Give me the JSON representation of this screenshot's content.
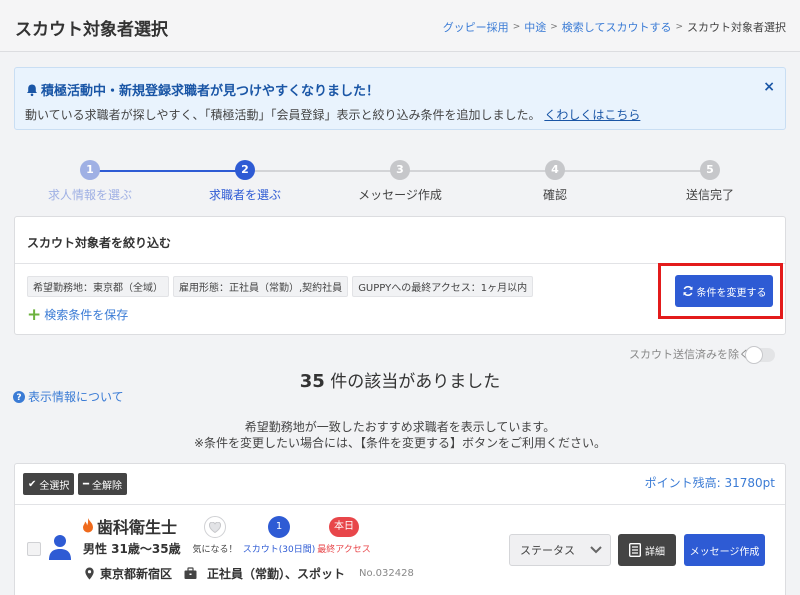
{
  "header": {
    "title": "スカウト対象者選択",
    "breadcrumb": [
      "グッピー採用",
      "中途",
      "検索してスカウトする"
    ],
    "breadcrumb_current": "スカウト対象者選択"
  },
  "notice": {
    "title": "積極活動中・新規登録求職者が見つけやすくなりました！",
    "body": "動いている求職者が探しやすく、「積極活動」「会員登録」表示と絞り込み条件を追加しました。",
    "link": "くわしくはこちら",
    "close_icon": "×"
  },
  "stepper": {
    "steps": [
      {
        "number": "1",
        "label": "求人情報を選ぶ",
        "state": "done"
      },
      {
        "number": "2",
        "label": "求職者を選ぶ",
        "state": "current"
      },
      {
        "number": "3",
        "label": "メッセージ作成",
        "state": "todo"
      },
      {
        "number": "4",
        "label": "確認",
        "state": "todo"
      },
      {
        "number": "5",
        "label": "送信完了",
        "state": "todo"
      }
    ]
  },
  "filter": {
    "title": "スカウト対象者を絞り込む",
    "tags": [
      "希望勤務地：東京都（全域）",
      "雇用形態：正社員（常勤）,契約社員",
      "GUPPYへの最終アクセス：1ヶ月以内"
    ],
    "save_label": "検索条件を保存",
    "change_button": "条件を変更する"
  },
  "toggle": {
    "label": "スカウト送信済みを除く",
    "on": false
  },
  "results": {
    "count": "35",
    "count_suffix": "件の該当がありました",
    "info_link": "表示情報について",
    "desc_line1": "希望勤務地が一致したおすすめ求職者を表示しています。",
    "desc_line2": "※条件を変更したい場合には、【条件を変更する】ボタンをご利用ください。"
  },
  "list": {
    "select_all": "全選択",
    "deselect_all": "全解除",
    "points": "ポイント残高: 31780pt"
  },
  "candidate": {
    "job": "歯科衛生士",
    "info": "男性 31歳〜35歳",
    "location": "東京都新宿区",
    "employment": "正社員（常勤）、スポット",
    "number": "No.032428",
    "favorite_label": "気になる！",
    "scout_count": "1",
    "scout_label": "スカウト(30日間)",
    "access_value": "本日",
    "access_label": "最終アクセス",
    "status_placeholder": "ステータス",
    "detail_button": "詳細",
    "message_button": "メッセージ作成"
  },
  "colors": {
    "primary": "#2e5bd4",
    "step_done": "#9fb0e4",
    "step_todo": "#c6c7ca",
    "highlight": "#e31b1b",
    "link": "#3a7bd5",
    "access_red": "#e8464a"
  }
}
